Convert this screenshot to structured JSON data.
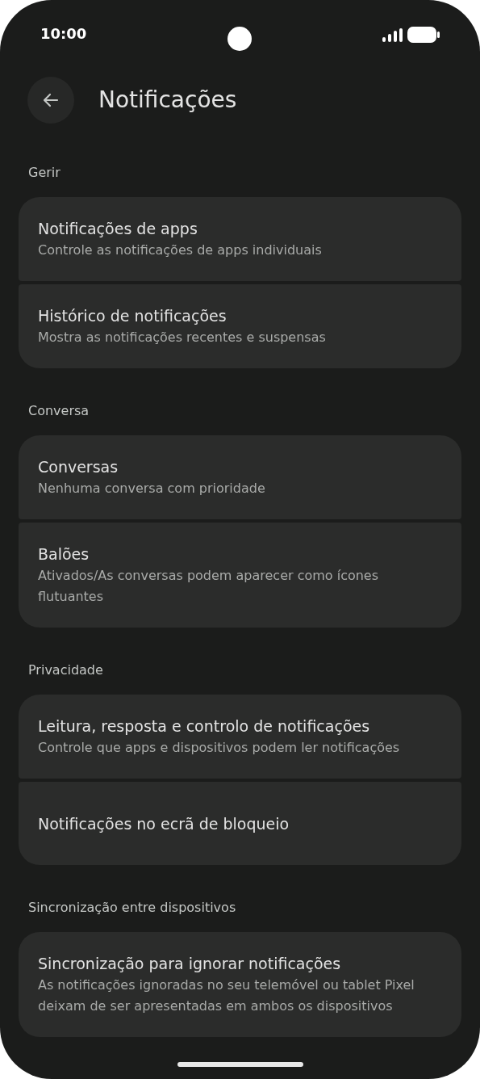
{
  "status_bar": {
    "time": "10:00"
  },
  "header": {
    "title": "Notificações"
  },
  "sections": [
    {
      "label": "Gerir",
      "items": [
        {
          "title": "Notificações de apps",
          "subtitle": "Controle as notificações de apps individuais"
        },
        {
          "title": "Histórico de notificações",
          "subtitle": "Mostra as notificações recentes e suspensas"
        }
      ]
    },
    {
      "label": "Conversa",
      "items": [
        {
          "title": "Conversas",
          "subtitle": "Nenhuma conversa com prioridade"
        },
        {
          "title": "Balões",
          "subtitle": "Ativados/As conversas podem aparecer como ícones flutuantes"
        }
      ]
    },
    {
      "label": "Privacidade",
      "items": [
        {
          "title": "Leitura, resposta e controlo de notificações",
          "subtitle": "Controle que apps e dispositivos podem ler notificações"
        },
        {
          "title": "Notificações no ecrã de bloqueio"
        }
      ]
    },
    {
      "label": "Sincronização entre dispositivos",
      "items": [
        {
          "title": "Sincronização para ignorar notificações",
          "subtitle": "As notificações ignoradas no seu telemóvel ou tablet Pixel deixam de ser apresentadas em ambos os dispositivos"
        }
      ]
    }
  ]
}
